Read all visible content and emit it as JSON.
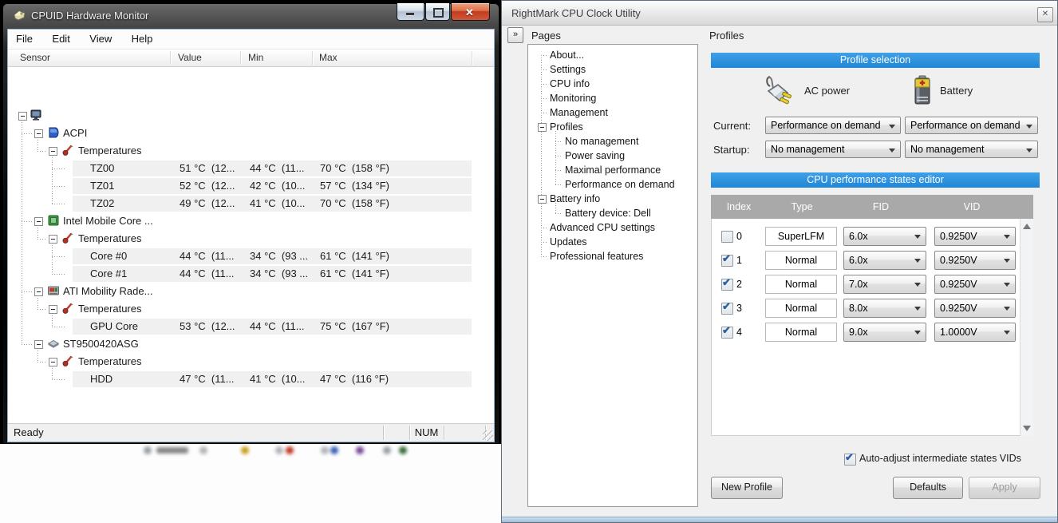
{
  "colors": {
    "accent_blue": "#2d96e2",
    "table_header_gray": "#a9a9a9",
    "close_button_red": "#c8432c"
  },
  "hwmonitor": {
    "title": "CPUID Hardware Monitor",
    "menu": {
      "file": "File",
      "edit": "Edit",
      "view": "View",
      "help": "Help"
    },
    "columns": {
      "sensor": "Sensor",
      "value": "Value",
      "min": "Min",
      "max": "Max"
    },
    "tree": [
      {
        "icon": "computer-icon",
        "label": ""
      },
      {
        "icon": "device-icon",
        "label": "ACPI"
      },
      {
        "icon": "temperature-icon",
        "label": "Temperatures"
      },
      {
        "label": "TZ00",
        "value": "51 °C  (12...",
        "min": "44 °C  (11...",
        "max": "70 °C  (158 °F)"
      },
      {
        "label": "TZ01",
        "value": "52 °C  (12...",
        "min": "42 °C  (10...",
        "max": "57 °C  (134 °F)"
      },
      {
        "label": "TZ02",
        "value": "49 °C  (12...",
        "min": "41 °C  (10...",
        "max": "70 °C  (158 °F)"
      },
      {
        "icon": "cpu-icon",
        "label": "Intel Mobile Core ..."
      },
      {
        "icon": "temperature-icon",
        "label": "Temperatures"
      },
      {
        "label": "Core #0",
        "value": "44 °C  (11...",
        "min": "34 °C  (93 ...",
        "max": "61 °C  (141 °F)"
      },
      {
        "label": "Core #1",
        "value": "44 °C  (11...",
        "min": "34 °C  (93 ...",
        "max": "61 °C  (141 °F)"
      },
      {
        "icon": "gpu-icon",
        "label": "ATI Mobility Rade..."
      },
      {
        "icon": "temperature-icon",
        "label": "Temperatures"
      },
      {
        "label": "GPU Core",
        "value": "53 °C  (12...",
        "min": "44 °C  (11...",
        "max": "75 °C  (167 °F)"
      },
      {
        "icon": "hdd-icon",
        "label": "ST9500420ASG"
      },
      {
        "icon": "temperature-icon",
        "label": "Temperatures"
      },
      {
        "label": "HDD",
        "value": "47 °C  (11...",
        "min": "41 °C  (10...",
        "max": "47 °C  (116 °F)"
      }
    ],
    "status": {
      "ready": "Ready",
      "num": "NUM"
    }
  },
  "rmclock": {
    "title": "RightMark CPU Clock Utility",
    "chevron": "»",
    "pages_label": "Pages",
    "profiles_label": "Profiles",
    "pages": [
      {
        "label": "About..."
      },
      {
        "label": "Settings"
      },
      {
        "label": "CPU info"
      },
      {
        "label": "Monitoring"
      },
      {
        "label": "Management"
      },
      {
        "label": "Profiles",
        "expanded": true
      },
      {
        "label": "No management",
        "child": true
      },
      {
        "label": "Power saving",
        "child": true
      },
      {
        "label": "Maximal performance",
        "child": true
      },
      {
        "label": "Performance on demand",
        "child": true
      },
      {
        "label": "Battery info",
        "expanded": true
      },
      {
        "label": "Battery device: Dell",
        "child": true
      },
      {
        "label": "Advanced CPU settings"
      },
      {
        "label": "Updates"
      },
      {
        "label": "Professional features"
      }
    ],
    "profile_selection": {
      "header": "Profile selection",
      "ac_icon": "ac-plug-icon",
      "battery_icon": "battery-icon",
      "ac_label": "AC power",
      "battery_label": "Battery",
      "current_label": "Current:",
      "startup_label": "Startup:",
      "ac_current": "Performance on demand",
      "battery_current": "Performance on demand",
      "ac_startup": "No management",
      "battery_startup": "No management"
    },
    "editor": {
      "header": "CPU performance states editor",
      "columns": {
        "index": "Index",
        "type": "Type",
        "fid": "FID",
        "vid": "VID"
      },
      "rows": [
        {
          "checked": false,
          "index": "0",
          "type": "SuperLFM",
          "fid": "6.0x",
          "vid": "0.9250V"
        },
        {
          "checked": true,
          "index": "1",
          "type": "Normal",
          "fid": "6.0x",
          "vid": "0.9250V"
        },
        {
          "checked": true,
          "index": "2",
          "type": "Normal",
          "fid": "7.0x",
          "vid": "0.9250V"
        },
        {
          "checked": true,
          "index": "3",
          "type": "Normal",
          "fid": "8.0x",
          "vid": "0.9250V"
        },
        {
          "checked": true,
          "index": "4",
          "type": "Normal",
          "fid": "9.0x",
          "vid": "1.0000V"
        }
      ]
    },
    "auto_adjust": {
      "checked": true,
      "label": "Auto-adjust intermediate states VIDs"
    },
    "buttons": {
      "new_profile": "New Profile",
      "defaults": "Defaults",
      "apply": "Apply"
    }
  }
}
